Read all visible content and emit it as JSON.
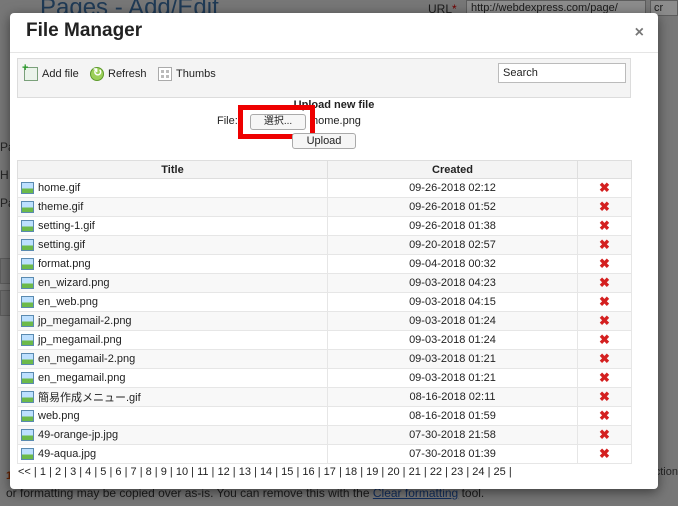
{
  "background": {
    "page_title": "Pages - Add/Edit",
    "url_label": "URL",
    "url_required": "*",
    "url_value": "http://webdexpress.com/page/",
    "url_value2": "cr",
    "side_labels": [
      "Pa",
      "H",
      "Pa"
    ],
    "right_edge_text": "ction",
    "bottom_text_before": "or formatting may be copied over as-is. You can remove this with the ",
    "bottom_link": "Clear formatting",
    "bottom_text_after": " tool.",
    "bottom_number": "1"
  },
  "dialog": {
    "title": "File Manager",
    "close_glyph": "×",
    "toolbar": {
      "add_file": "Add file",
      "refresh": "Refresh",
      "thumbs": "Thumbs",
      "search_placeholder": "Search"
    },
    "upload": {
      "title": "Upload new file",
      "file_label": "File:",
      "choose_button": "選択...",
      "chosen_file": "home.png",
      "upload_button": "Upload"
    },
    "table": {
      "headers": {
        "title": "Title",
        "created": "Created"
      },
      "rows": [
        {
          "title": "home.gif",
          "created": "09-26-2018 02:12"
        },
        {
          "title": "theme.gif",
          "created": "09-26-2018 01:52"
        },
        {
          "title": "setting-1.gif",
          "created": "09-26-2018 01:38"
        },
        {
          "title": "setting.gif",
          "created": "09-20-2018 02:57"
        },
        {
          "title": "format.png",
          "created": "09-04-2018 00:32"
        },
        {
          "title": "en_wizard.png",
          "created": "09-03-2018 04:23"
        },
        {
          "title": "en_web.png",
          "created": "09-03-2018 04:15"
        },
        {
          "title": "jp_megamail-2.png",
          "created": "09-03-2018 01:24"
        },
        {
          "title": "jp_megamail.png",
          "created": "09-03-2018 01:24"
        },
        {
          "title": "en_megamail-2.png",
          "created": "09-03-2018 01:21"
        },
        {
          "title": "en_megamail.png",
          "created": "09-03-2018 01:21"
        },
        {
          "title": "簡易作成メニュー.gif",
          "created": "08-16-2018 02:11"
        },
        {
          "title": "web.png",
          "created": "08-16-2018 01:59"
        },
        {
          "title": "49-orange-jp.jpg",
          "created": "07-30-2018 21:58"
        },
        {
          "title": "49-aqua.jpg",
          "created": "07-30-2018 01:39"
        }
      ],
      "delete_glyph": "✖"
    },
    "pager": {
      "first": "<<",
      "pages": [
        "1",
        "2",
        "3",
        "4",
        "5",
        "6",
        "7",
        "8",
        "9",
        "10",
        "11",
        "12",
        "13",
        "14",
        "15",
        "16",
        "17",
        "18",
        "19",
        "20",
        "21",
        "22",
        "23",
        "24",
        "25"
      ],
      "separator": "|"
    }
  }
}
